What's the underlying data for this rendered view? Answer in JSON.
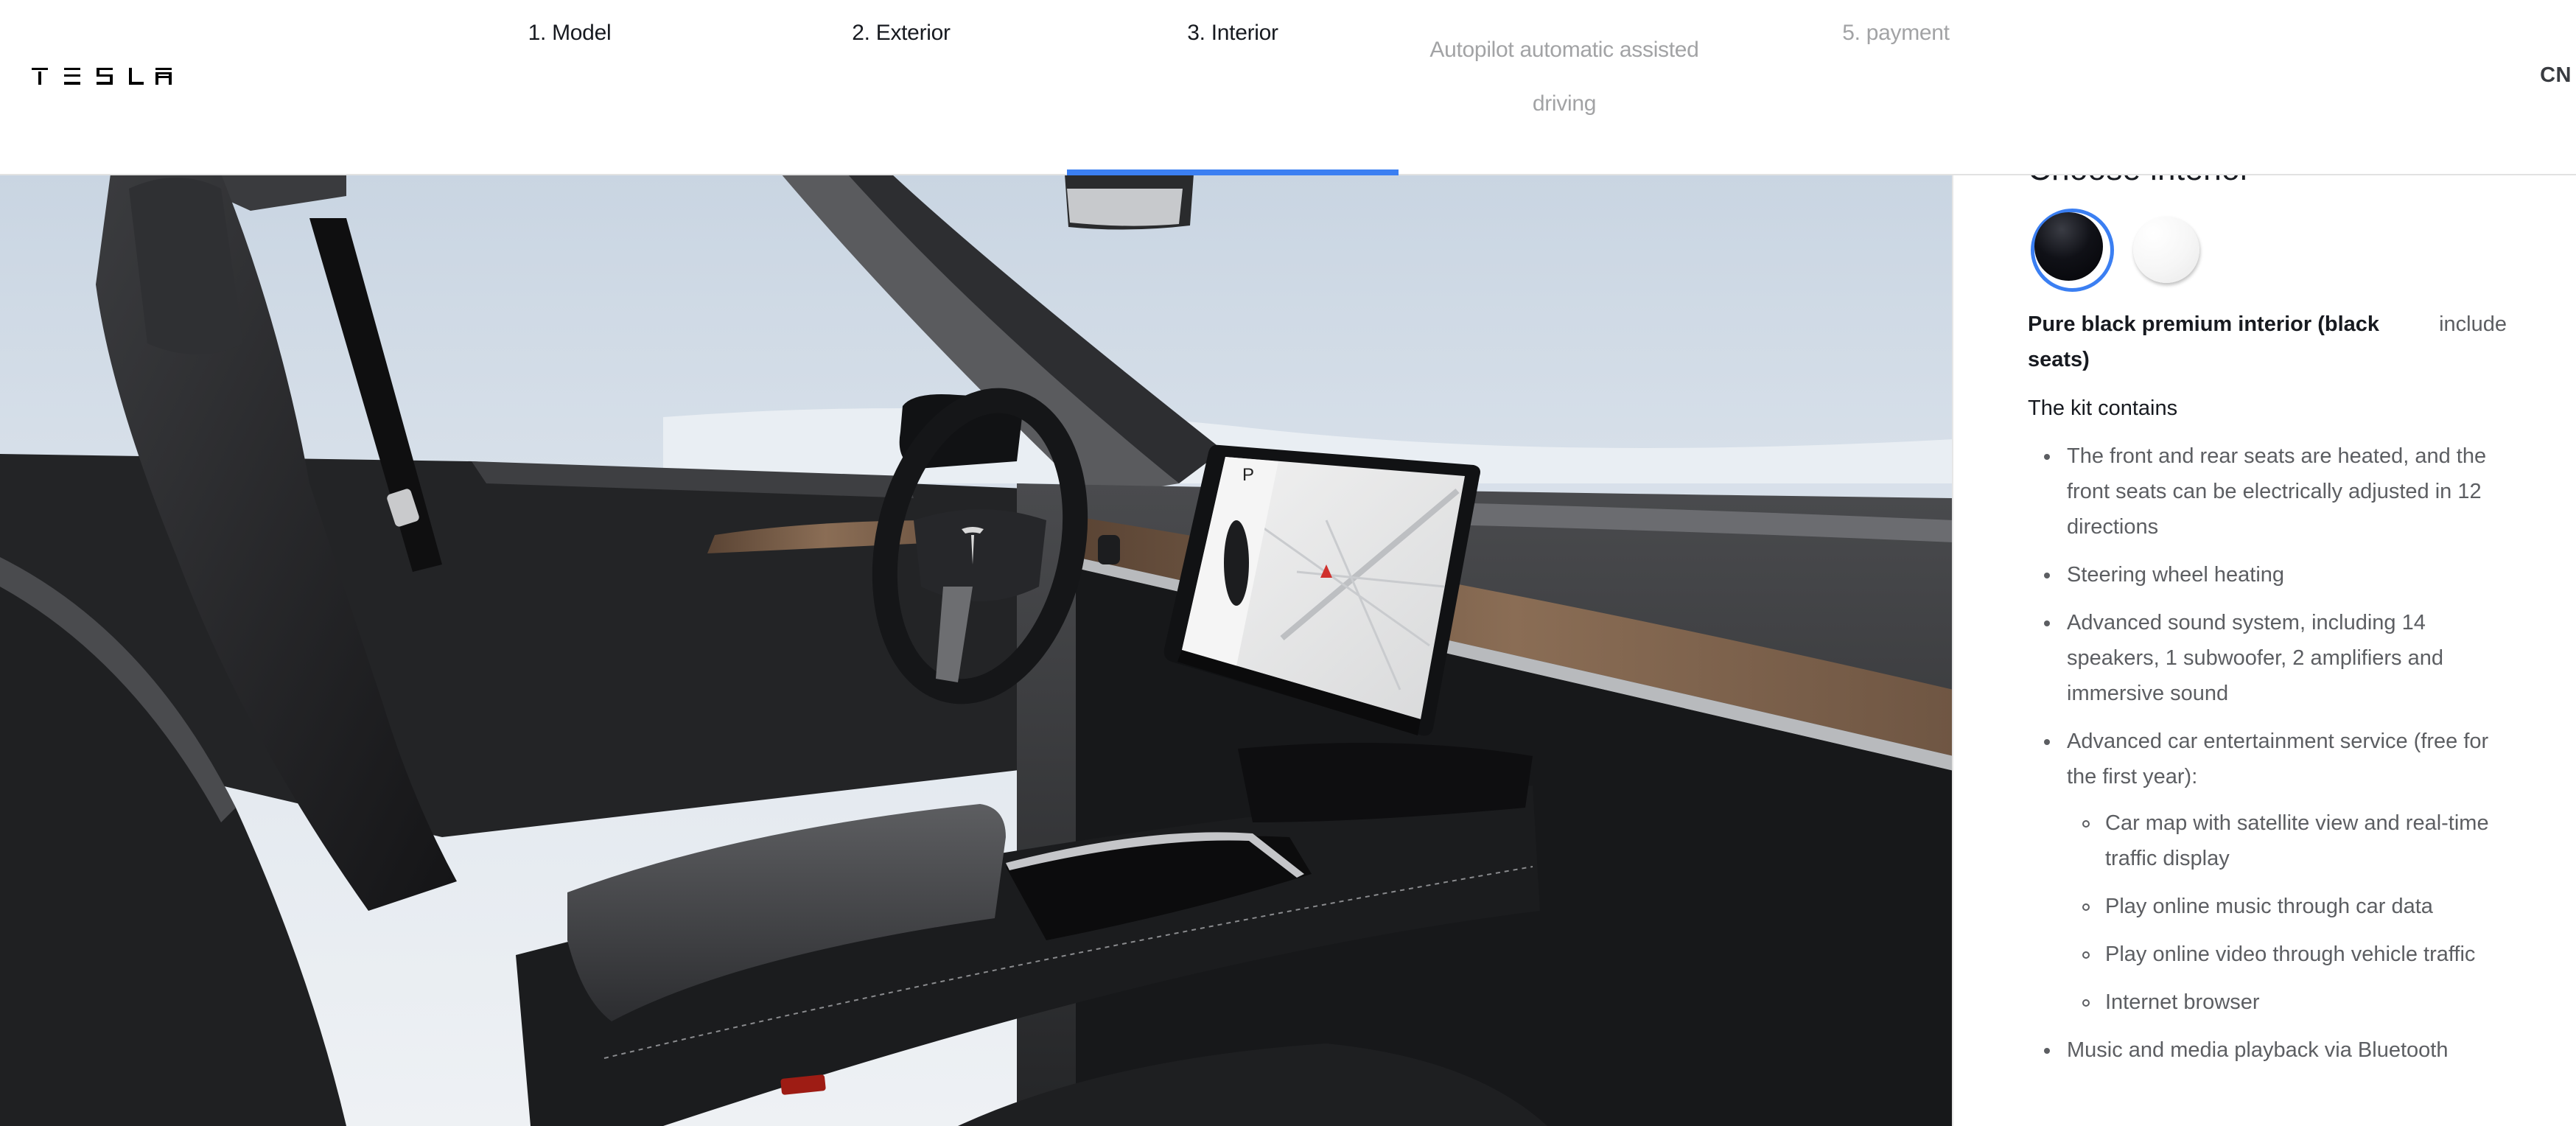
{
  "brand": {
    "logo_text": "TESLA",
    "logo_icon": "tesla-wordmark-icon"
  },
  "steps": [
    {
      "label": "1. Model",
      "state": "done"
    },
    {
      "label": "2. Exterior",
      "state": "done"
    },
    {
      "label": "3. Interior",
      "state": "active"
    },
    {
      "label": "Autopilot automatic assisted driving",
      "state": "pending"
    },
    {
      "label": "5. payment",
      "state": "pending"
    }
  ],
  "progress": {
    "active_step": 3,
    "total_steps": 5
  },
  "region": {
    "label": "CN"
  },
  "colors": {
    "accent": "#3b7ff2",
    "text_primary": "#171a20",
    "text_secondary": "#5c5e62",
    "text_muted": "#a2a3a5",
    "divider": "#e2e2e2"
  },
  "visual": {
    "description": "Car interior view with black seats, steering wheel, wood dash trim and center touchscreen",
    "screen_gear": "P"
  },
  "panel": {
    "title": "Choose interior",
    "swatches": [
      {
        "name": "Pure black",
        "color": "#0b0c10",
        "selected": true
      },
      {
        "name": "White",
        "color": "#f4f4f4",
        "selected": false
      }
    ],
    "selected_option": {
      "name": "Pure black premium interior (black seats)",
      "price": "include"
    },
    "kit_title": "The kit contains",
    "features": [
      {
        "text": "The front and rear seats are heated, and the front seats can be electrically adjusted in 12 directions"
      },
      {
        "text": "Steering wheel heating"
      },
      {
        "text": "Advanced sound system, including 14 speakers, 1 subwoofer, 2 amplifiers and immersive sound"
      },
      {
        "text": "Advanced car entertainment service (free for the first year):",
        "sub": [
          "Car map with satellite view and real-time traffic display",
          "Play online music through car data",
          "Play online video through vehicle traffic",
          "Internet browser"
        ]
      },
      {
        "text": "Music and media playback via Bluetooth"
      }
    ]
  }
}
